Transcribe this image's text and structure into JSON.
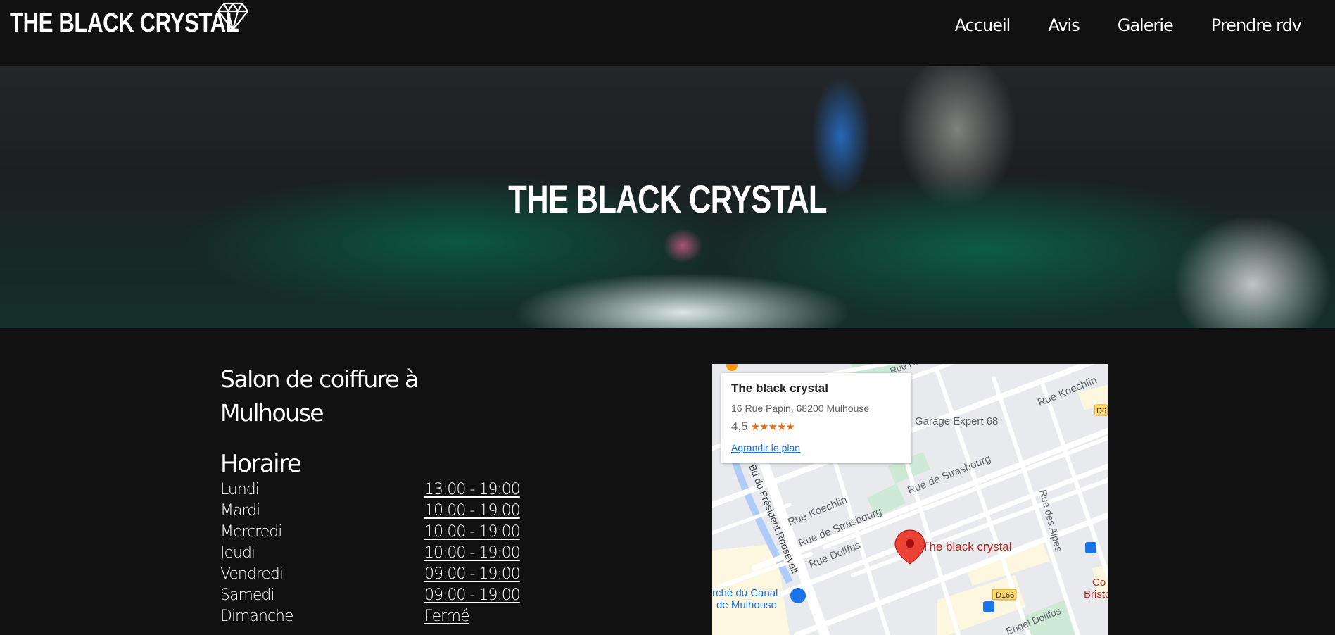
{
  "header": {
    "brand": "THE BLACK CRYSTAL",
    "brand_icon": "diamond-icon",
    "nav": [
      "Accueil",
      "Avis",
      "Galerie",
      "Prendre rdv"
    ]
  },
  "hero": {
    "title": "THE BLACK CRYSTAL"
  },
  "info": {
    "title": "Salon de coiffure à Mulhouse",
    "hours_heading": "Horaire",
    "hours": [
      {
        "day": "Lundi",
        "time": "13:00 - 19:00"
      },
      {
        "day": "Mardi",
        "time": "10:00 - 19:00"
      },
      {
        "day": "Mercredi",
        "time": "10:00 - 19:00"
      },
      {
        "day": "Jeudi",
        "time": "10:00 - 19:00"
      },
      {
        "day": "Vendredi",
        "time": "09:00 - 19:00"
      },
      {
        "day": "Samedi",
        "time": "09:00 - 19:00"
      },
      {
        "day": "Dimanche",
        "time": "Fermé"
      }
    ]
  },
  "map": {
    "place_name": "The black crystal",
    "address": "16 Rue Papin, 68200 Mulhouse",
    "rating": "4,5",
    "rating_stars": "★★★★★",
    "link": "Agrandir le plan",
    "pin_label": "The black crystal",
    "labels": {
      "garage": "Garage Expert 68",
      "rue_koechlin": "Rue Koechlin",
      "rue_koechlin_2": "Rue Koechlin",
      "rue_strasbourg": "Rue de Strasbourg",
      "rue_strasbourg_2": "Rue de Strasbourg",
      "rue_dollfus": "Rue Dollfus",
      "bd_roosevelt": "Bd du Président Roosevelt",
      "marche_1": "rché du Canal",
      "marche_2": "de Mulhouse",
      "rue_des_alpes": "Rue des Alpes",
      "rue_hubner": "Rue Hubner",
      "engel_dollfus": "Engel Dollfus",
      "d166": "D166",
      "d6": "D6",
      "bristol_1": "Co",
      "bristol_2": "Bristo"
    }
  },
  "colors": {
    "background": "#111111",
    "text": "#ffffff",
    "map_link": "#1a73e8",
    "pin": "#ea4335",
    "stars": "#e7711b"
  }
}
